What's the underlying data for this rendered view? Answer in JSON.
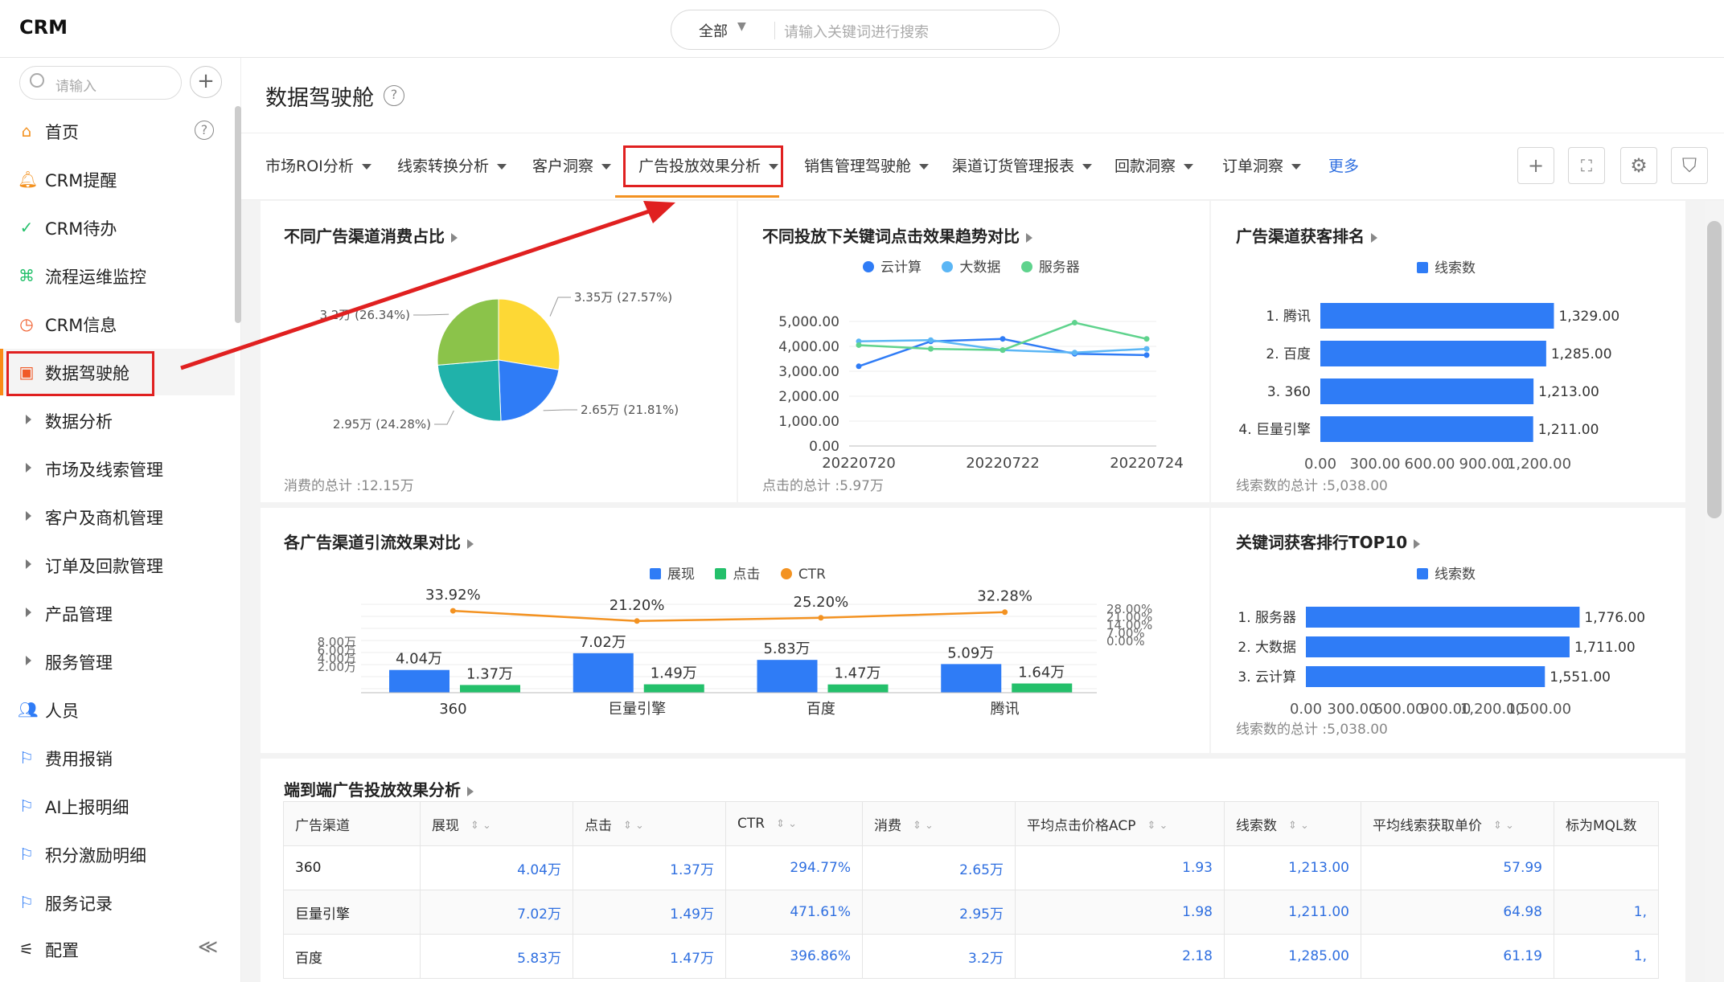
{
  "app": {
    "brand": "CRM"
  },
  "search": {
    "scope": "全部",
    "placeholder": "请输入关键词进行搜索"
  },
  "sidebar": {
    "search_placeholder": "请输入",
    "items": [
      {
        "label": "首页",
        "icon": "home-icon"
      },
      {
        "label": "CRM提醒",
        "icon": "bell-icon"
      },
      {
        "label": "CRM待办",
        "icon": "check-circle-icon"
      },
      {
        "label": "流程运维监控",
        "icon": "flow-icon"
      },
      {
        "label": "CRM信息",
        "icon": "clock-icon"
      },
      {
        "label": "数据驾驶舱",
        "icon": "dashboard-icon",
        "active": true
      },
      {
        "label": "数据分析",
        "icon": "expand-arrow-icon"
      },
      {
        "label": "市场及线索管理",
        "icon": "expand-arrow-icon"
      },
      {
        "label": "客户及商机管理",
        "icon": "expand-arrow-icon"
      },
      {
        "label": "订单及回款管理",
        "icon": "expand-arrow-icon"
      },
      {
        "label": "产品管理",
        "icon": "expand-arrow-icon"
      },
      {
        "label": "服务管理",
        "icon": "expand-arrow-icon"
      },
      {
        "label": "人员",
        "icon": "people-icon"
      },
      {
        "label": "费用报销",
        "icon": "flag-icon"
      },
      {
        "label": "AI上报明细",
        "icon": "flag-icon"
      },
      {
        "label": "积分激励明细",
        "icon": "flag-icon"
      },
      {
        "label": "服务记录",
        "icon": "flag-icon"
      }
    ],
    "footer_label": "配置",
    "collapse_glyph": "≪"
  },
  "page": {
    "title": "数据驾驶舱"
  },
  "tabs": [
    "市场ROI分析",
    "线索转换分析",
    "客户洞察",
    "广告投放效果分析",
    "销售管理驾驶舱",
    "渠道订货管理报表",
    "回款洞察",
    "订单洞察"
  ],
  "tabs_more": "更多",
  "toolbar": {
    "add": "+",
    "fullscreen": "⛶",
    "settings": "⚙",
    "shield": "⛉"
  },
  "colors": {
    "blue": "#2f7cf6",
    "orange": "#f39221",
    "green": "#24c06b",
    "accent_red": "#e02020"
  },
  "cards": {
    "pie": {
      "title": "不同广告渠道消费占比",
      "footer": "消费的总计 :12.15万",
      "labels": [
        "3.35万 (27.57%)",
        "2.65万 (21.81%)",
        "2.95万 (24.28%)",
        "3.2万 (26.34%)"
      ]
    },
    "line": {
      "title": "不同投放下关键词点击效果趋势对比",
      "footer": "点击的总计 :5.97万",
      "legend": [
        "云计算",
        "大数据",
        "服务器"
      ],
      "yticks": [
        "5,000.00",
        "4,000.00",
        "3,000.00",
        "2,000.00",
        "1,000.00",
        "0.00"
      ],
      "xticks": [
        "20220720",
        "20220722",
        "20220724"
      ]
    },
    "rank": {
      "title": "广告渠道获客排名",
      "legend": "线索数",
      "footer": "线索数的总计 :5,038.00",
      "xticks": [
        "0.00",
        "300.00",
        "600.00",
        "900.00",
        "1,200.00"
      ]
    },
    "combo": {
      "title": "各广告渠道引流效果对比",
      "legend": [
        "展现",
        "点击",
        "CTR"
      ],
      "bar_labels": [
        "4.04万",
        "1.37万",
        "7.02万",
        "1.49万",
        "5.83万",
        "1.47万",
        "5.09万",
        "1.64万"
      ],
      "ctr_labels": [
        "33.92%",
        "21.20%",
        "25.20%",
        "32.28%"
      ],
      "yticks": [
        "8.00万",
        "6.00万",
        "4.00万",
        "2.00万"
      ],
      "y2ticks": [
        "28.00%",
        "21.00%",
        "14.00%",
        "7.00%",
        "0.00%"
      ]
    },
    "kw": {
      "title": "关键词获客排行TOP10",
      "legend": "线索数",
      "footer": "线索数的总计 :5,038.00",
      "xticks": [
        "0.00",
        "300.00",
        "600.00",
        "900.00",
        "1,200.00",
        "1,500.00"
      ]
    },
    "table": {
      "title": "端到端广告投放效果分析"
    }
  },
  "chart_data": [
    {
      "type": "pie",
      "title": "不同广告渠道消费占比",
      "slices": [
        {
          "label": "3.35万 (27.57%)",
          "value": 3.35,
          "percent": 27.57,
          "color": "#fdd835"
        },
        {
          "label": "2.65万 (21.81%)",
          "value": 2.65,
          "percent": 21.81,
          "color": "#2f7cf6"
        },
        {
          "label": "2.95万 (24.28%)",
          "value": 2.95,
          "percent": 24.28,
          "color": "#20b2aa"
        },
        {
          "label": "3.2万 (26.34%)",
          "value": 3.2,
          "percent": 26.34,
          "color": "#8bc34a"
        }
      ]
    },
    {
      "type": "line",
      "title": "不同投放下关键词点击效果趋势对比",
      "x": [
        "20220720",
        "20220721",
        "20220722",
        "20220723",
        "20220724"
      ],
      "ylim": [
        0,
        5000
      ],
      "series": [
        {
          "name": "云计算",
          "color": "#2f7cf6",
          "values": [
            3200,
            4200,
            4300,
            3700,
            3650
          ]
        },
        {
          "name": "大数据",
          "color": "#5bb6f5",
          "values": [
            4200,
            4250,
            3850,
            3750,
            3900
          ]
        },
        {
          "name": "服务器",
          "color": "#5fd38d",
          "values": [
            4050,
            3900,
            3850,
            4950,
            4300
          ]
        }
      ]
    },
    {
      "type": "bar",
      "orientation": "horizontal",
      "title": "广告渠道获客排名",
      "categories": [
        "1. 腾讯",
        "2. 百度",
        "3. 360",
        "4. 巨量引擎"
      ],
      "values": [
        1329,
        1285,
        1213,
        1211
      ],
      "value_labels": [
        "1,329.00",
        "1,285.00",
        "1,213.00",
        "1,211.00"
      ],
      "xlim": [
        0,
        1400
      ]
    },
    {
      "type": "bar",
      "title": "各广告渠道引流效果对比",
      "categories": [
        "360",
        "巨量引擎",
        "百度",
        "腾讯"
      ],
      "series": [
        {
          "name": "展现",
          "color": "#2f7cf6",
          "values": [
            4.04,
            7.02,
            5.83,
            5.09
          ]
        },
        {
          "name": "点击",
          "color": "#24c06b",
          "values": [
            1.37,
            1.49,
            1.47,
            1.64
          ]
        },
        {
          "name": "CTR",
          "color": "#f39221",
          "values": [
            33.92,
            21.2,
            25.2,
            32.28
          ]
        }
      ],
      "ylim": [
        0,
        8
      ],
      "y2lim": [
        0,
        28
      ]
    },
    {
      "type": "bar",
      "orientation": "horizontal",
      "title": "关键词获客排行TOP10",
      "categories": [
        "1. 服务器",
        "2. 大数据",
        "3. 云计算"
      ],
      "values": [
        1776,
        1711,
        1551
      ],
      "value_labels": [
        "1,776.00",
        "1,711.00",
        "1,551.00"
      ],
      "xlim": [
        0,
        1800
      ]
    }
  ],
  "table": {
    "columns": [
      "广告渠道",
      "展现",
      "点击",
      "CTR",
      "消费",
      "平均点击价格ACP",
      "线索数",
      "平均线索获取单价",
      "标为MQL数"
    ],
    "rows": [
      [
        "360",
        "4.04万",
        "1.37万",
        "294.77%",
        "2.65万",
        "1.93",
        "1,213.00",
        "57.99",
        ""
      ],
      [
        "巨量引擎",
        "7.02万",
        "1.49万",
        "471.61%",
        "2.95万",
        "1.98",
        "1,211.00",
        "64.98",
        "1,"
      ],
      [
        "百度",
        "5.83万",
        "1.47万",
        "396.86%",
        "3.2万",
        "2.18",
        "1,285.00",
        "61.19",
        "1,"
      ]
    ]
  }
}
